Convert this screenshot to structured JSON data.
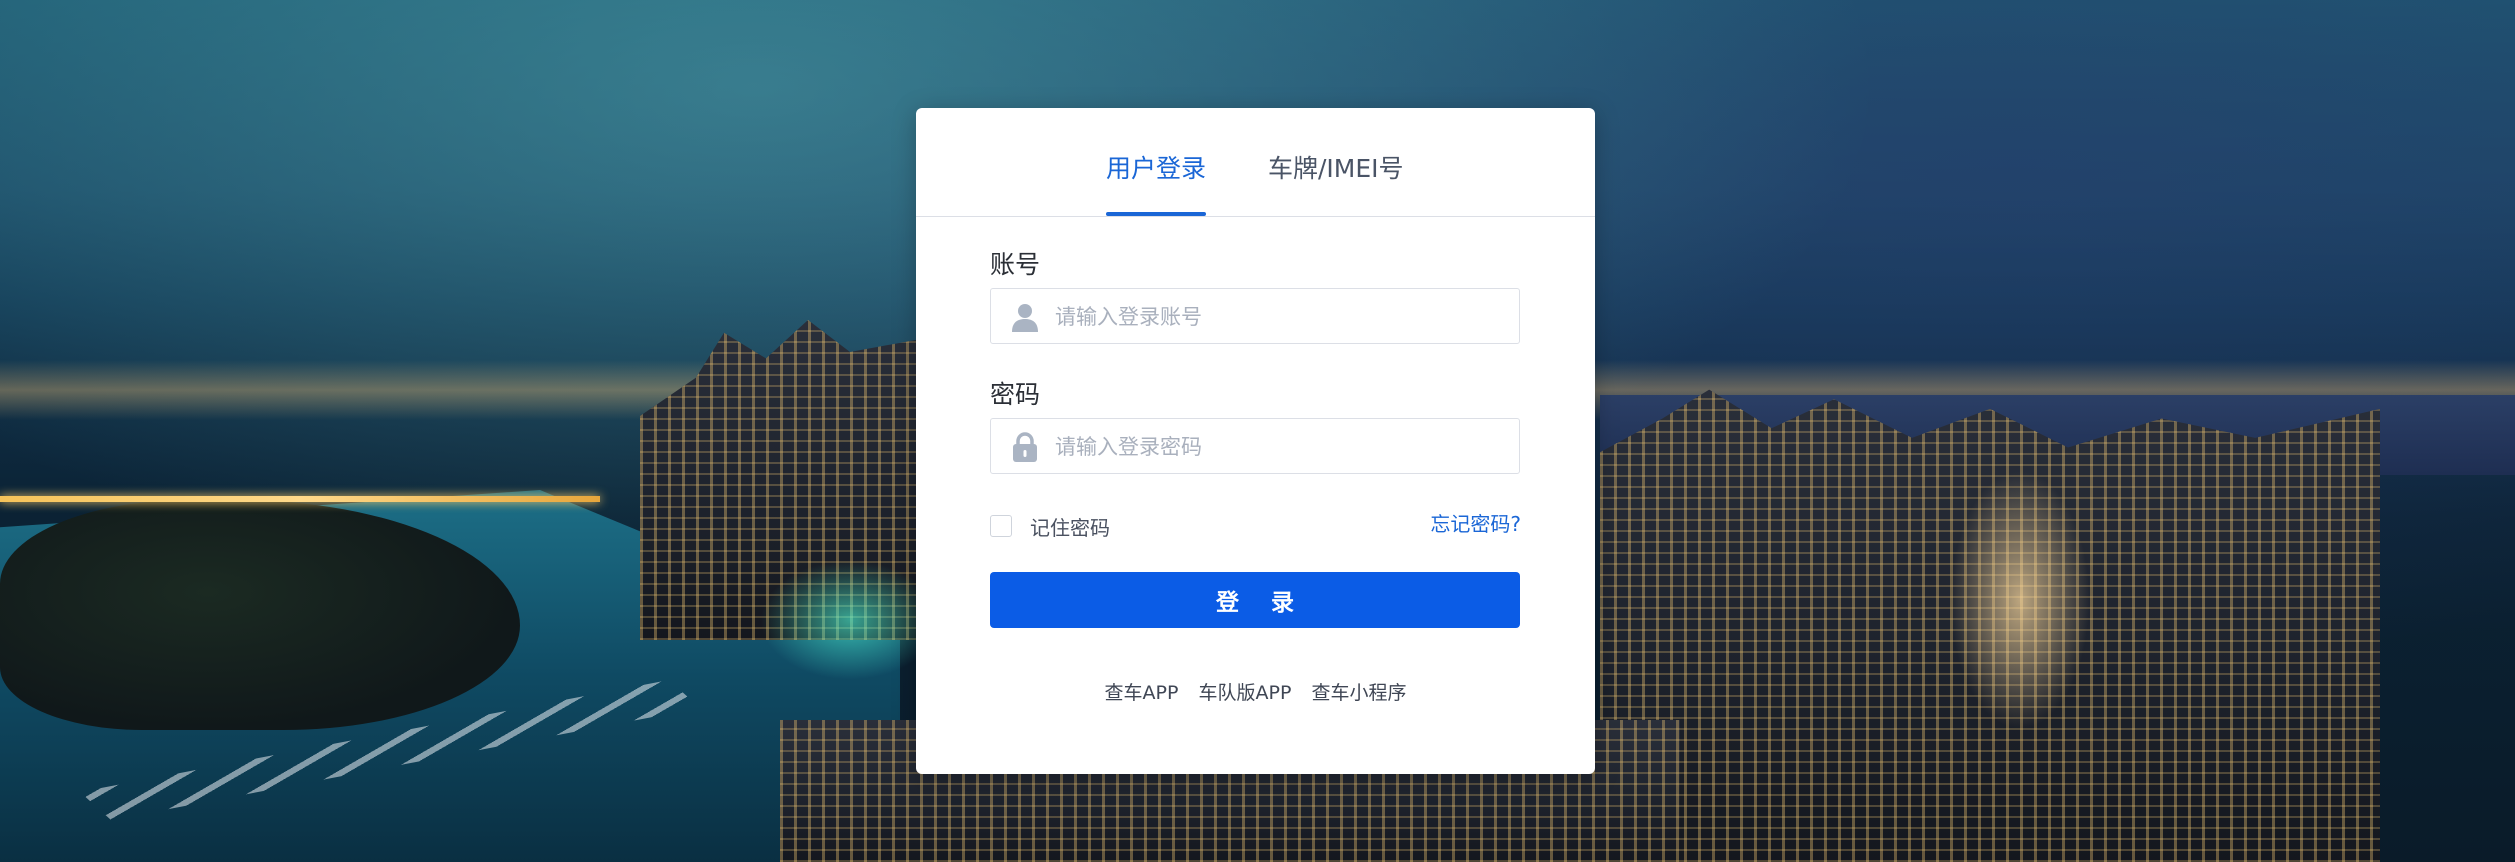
{
  "tabs": {
    "user_login": "用户登录",
    "plate_imei": "车牌/IMEI号",
    "active": "user_login"
  },
  "form": {
    "account_label": "账号",
    "account_placeholder": "请输入登录账号",
    "account_value": "",
    "password_label": "密码",
    "password_placeholder": "请输入登录密码",
    "password_value": "",
    "remember_label": "记住密码",
    "remember_checked": false,
    "forgot_label": "忘记密码?",
    "login_button": "登 录"
  },
  "footer_links": {
    "app": "查车APP",
    "fleet_app": "车队版APP",
    "mini_program": "查车小程序"
  },
  "icons": {
    "account": "user-icon",
    "password": "lock-icon"
  },
  "colors": {
    "primary": "#0b5ce6",
    "tab_active": "#1a66d6",
    "link": "#1a66d6"
  }
}
